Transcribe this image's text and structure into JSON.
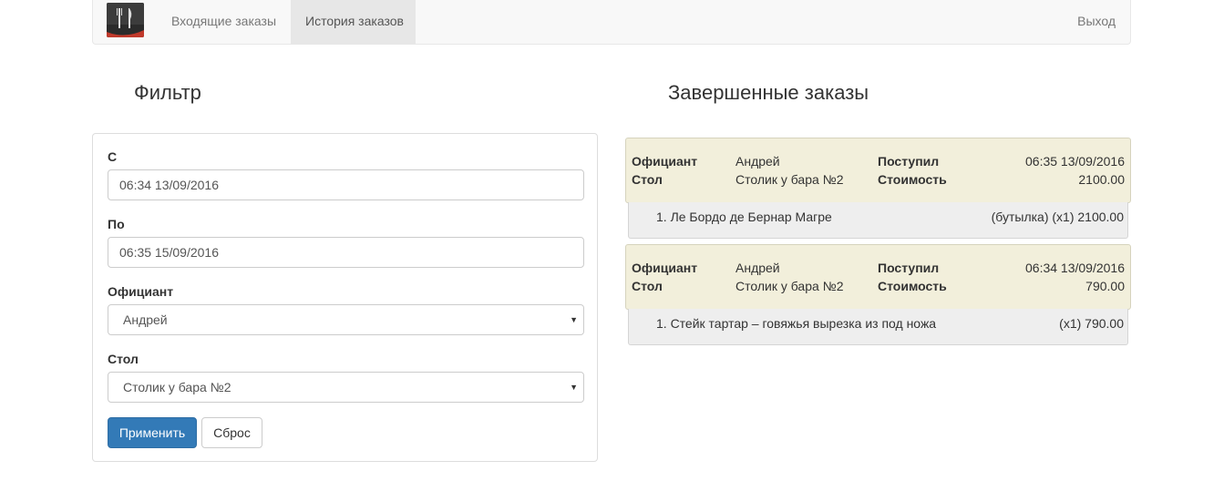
{
  "nav": {
    "items": [
      {
        "label": "Входящие заказы"
      },
      {
        "label": "История заказов"
      }
    ],
    "logout_label": "Выход"
  },
  "filter": {
    "title": "Фильтр",
    "from_label": "С",
    "from_value": "06:34 13/09/2016",
    "to_label": "По",
    "to_value": "06:35 15/09/2016",
    "waiter_label": "Официант",
    "waiter_value": "Андрей",
    "table_label": "Стол",
    "table_value": "Столик у бара №2",
    "apply_label": "Применить",
    "reset_label": "Сброс"
  },
  "orders": {
    "title": "Завершенные заказы",
    "waiter_key": "Официант",
    "table_key": "Стол",
    "received_key": "Поступил",
    "cost_key": "Стоимость",
    "list": [
      {
        "waiter": "Андрей",
        "table": "Столик у бара №2",
        "received": "06:35 13/09/2016",
        "cost": "2100.00",
        "item_name": "1. Ле Бордо де Бернар Магре",
        "item_price": "(бутылка) (x1) 2100.00"
      },
      {
        "waiter": "Андрей",
        "table": "Столик у бара №2",
        "received": "06:34 13/09/2016",
        "cost": "790.00",
        "item_name": "1. Стейк тартар – говяжья вырезка из под ножа",
        "item_price": "(x1) 790.00"
      }
    ]
  },
  "colors": {
    "primary": "#337ab7",
    "order_header_bg": "#f2efdb",
    "order_body_bg": "#eeeeee",
    "navbar_bg": "#f8f8f8"
  },
  "icons": {
    "brand": "restaurant-logo-icon",
    "caret": "chevron-down-icon"
  }
}
